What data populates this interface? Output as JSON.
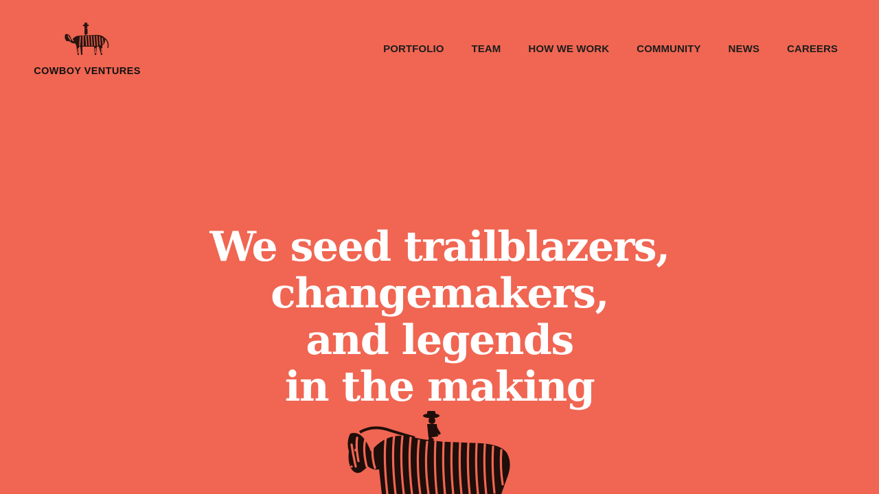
{
  "brand": {
    "name": "COWBOY VENTURES",
    "logo_icon": "zebra-rider-icon"
  },
  "nav": {
    "items": [
      {
        "label": "PORTFOLIO"
      },
      {
        "label": "TEAM"
      },
      {
        "label": "HOW WE WORK"
      },
      {
        "label": "COMMUNITY"
      },
      {
        "label": "NEWS"
      },
      {
        "label": "CAREERS"
      }
    ]
  },
  "hero": {
    "lines": [
      "We seed trailblazers,",
      "changemakers,",
      "and legends",
      "in the making"
    ],
    "illustration_icon": "zebra-rider-icon"
  },
  "colors": {
    "background": "#F06652",
    "text_dark": "#1c1c1c",
    "hero_text": "#ffffff"
  }
}
